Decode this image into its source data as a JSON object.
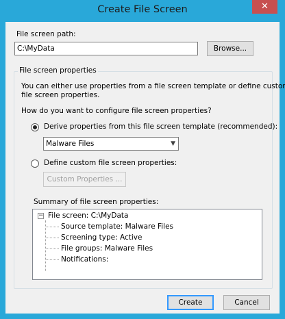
{
  "window": {
    "title": "Create File Screen",
    "close_glyph": "✕"
  },
  "path": {
    "label": "File screen path:",
    "value": "C:\\MyData",
    "browse_label": "Browse..."
  },
  "properties": {
    "group_title": "File screen properties",
    "description_line1": "You can either use properties from a file screen template or define custom",
    "description_line2": "file screen properties.",
    "question": "How do you want to configure file screen properties?",
    "option_derive": {
      "label": "Derive properties from this file screen template (recommended):",
      "selected": true
    },
    "template_select": {
      "value": "Malware Files"
    },
    "option_custom": {
      "label": "Define custom file screen properties:",
      "selected": false
    },
    "custom_button_label": "Custom Properties ...",
    "summary_label": "Summary of file screen properties:",
    "summary": {
      "root": "File screen: C:\\MyData",
      "expander_glyph": "−",
      "children": [
        "Source template: Malware Files",
        "Screening type: Active",
        "File groups: Malware Files",
        "Notifications:"
      ]
    }
  },
  "footer": {
    "create_label": "Create",
    "cancel_label": "Cancel"
  },
  "colors": {
    "titlebar": "#29a8d9",
    "close": "#c75050",
    "dialog_bg": "#f0f0f0"
  }
}
